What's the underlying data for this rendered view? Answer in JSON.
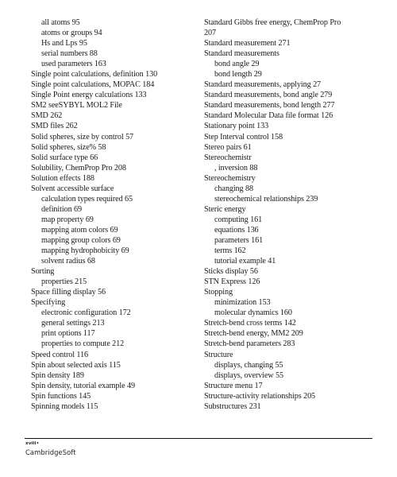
{
  "document": {
    "type": "index-page",
    "page_label": "xviii•",
    "publisher": "CambridgeSoft"
  },
  "columns": [
    {
      "name": "left-column",
      "entries": [
        {
          "text": "all atoms 95",
          "level": 1
        },
        {
          "text": "atoms or groups 94",
          "level": 1
        },
        {
          "text": "Hs and Lps 95",
          "level": 1
        },
        {
          "text": "serial numbers 88",
          "level": 1
        },
        {
          "text": "used parameters 163",
          "level": 1
        },
        {
          "text": "Single point calculations, definition 130",
          "level": 0
        },
        {
          "text": "Single point calculations, MOPAC 184",
          "level": 0
        },
        {
          "text": "Single Point energy calculations 133",
          "level": 0
        },
        {
          "text": "SM2 seeSYBYL MOL2 File",
          "level": 0
        },
        {
          "text": "SMD 262",
          "level": 0
        },
        {
          "text": "SMD files 262",
          "level": 0
        },
        {
          "text": "Solid spheres, size by control 57",
          "level": 0
        },
        {
          "text": "Solid spheres, size% 58",
          "level": 0
        },
        {
          "text": "Solid surface type 66",
          "level": 0
        },
        {
          "text": "Solubility, ChemProp Pro 208",
          "level": 0
        },
        {
          "text": "Solution effects 188",
          "level": 0
        },
        {
          "text": "Solvent accessible surface",
          "level": 0
        },
        {
          "text": "calculation types required 65",
          "level": 1
        },
        {
          "text": "definition 69",
          "level": 1
        },
        {
          "text": "map property 69",
          "level": 1
        },
        {
          "text": "mapping atom colors 69",
          "level": 1
        },
        {
          "text": "mapping group colors 69",
          "level": 1
        },
        {
          "text": "mapping hydrophobicity 69",
          "level": 1
        },
        {
          "text": "solvent radius 68",
          "level": 1
        },
        {
          "text": "Sorting",
          "level": 0
        },
        {
          "text": "properties 215",
          "level": 1
        },
        {
          "text": "Space filling display 56",
          "level": 0
        },
        {
          "text": "Specifying",
          "level": 0
        },
        {
          "text": "electronic configuration 172",
          "level": 1
        },
        {
          "text": "general settings 213",
          "level": 1
        },
        {
          "text": "print options 117",
          "level": 1
        },
        {
          "text": "properties to compute 212",
          "level": 1
        },
        {
          "text": "Speed control 116",
          "level": 0
        },
        {
          "text": "Spin about selected axis 115",
          "level": 0
        },
        {
          "text": "Spin density 189",
          "level": 0
        },
        {
          "text": "Spin density, tutorial example 49",
          "level": 0
        },
        {
          "text": "Spin functions 145",
          "level": 0
        },
        {
          "text": "Spinning models 115",
          "level": 0
        }
      ]
    },
    {
      "name": "right-column",
      "entries": [
        {
          "text": "Standard Gibbs free energy, ChemProp Pro",
          "level": 0
        },
        {
          "text": "207",
          "level": 0
        },
        {
          "text": "Standard measurement 271",
          "level": 0
        },
        {
          "text": "Standard measurements",
          "level": 0
        },
        {
          "text": "bond angle 29",
          "level": 1
        },
        {
          "text": "bond length 29",
          "level": 1
        },
        {
          "text": "Standard measurements, applying 27",
          "level": 0
        },
        {
          "text": "Standard measurements, bond angle 279",
          "level": 0
        },
        {
          "text": "Standard measurements, bond length 277",
          "level": 0
        },
        {
          "text": "Standard Molecular Data file format 126",
          "level": 0
        },
        {
          "text": "Stationary point 133",
          "level": 0
        },
        {
          "text": "Step Interval control 158",
          "level": 0
        },
        {
          "text": "Stereo pairs 61",
          "level": 0
        },
        {
          "text": "Stereochemistr",
          "level": 0
        },
        {
          "text": ", inversion 88",
          "level": 1
        },
        {
          "text": "Stereochemistry",
          "level": 0
        },
        {
          "text": "changing 88",
          "level": 1
        },
        {
          "text": "stereochemical relationships 239",
          "level": 1
        },
        {
          "text": "Steric energy",
          "level": 0
        },
        {
          "text": "computing 161",
          "level": 1
        },
        {
          "text": "equations 136",
          "level": 1
        },
        {
          "text": "parameters 161",
          "level": 1
        },
        {
          "text": "terms 162",
          "level": 1
        },
        {
          "text": "tutorial example 41",
          "level": 1
        },
        {
          "text": "Sticks display 56",
          "level": 0
        },
        {
          "text": "STN Express 126",
          "level": 0
        },
        {
          "text": "Stopping",
          "level": 0
        },
        {
          "text": "minimization 153",
          "level": 1
        },
        {
          "text": "molecular dynamics 160",
          "level": 1
        },
        {
          "text": "Stretch-bend cross terms 142",
          "level": 0
        },
        {
          "text": "Stretch-bend energy, MM2 209",
          "level": 0
        },
        {
          "text": "Stretch-bend parameters 283",
          "level": 0
        },
        {
          "text": "Structure",
          "level": 0
        },
        {
          "text": "displays, changing 55",
          "level": 1
        },
        {
          "text": "displays, overview 55",
          "level": 1
        },
        {
          "text": "Structure menu 17",
          "level": 0
        },
        {
          "text": "Structure-activity relationships 205",
          "level": 0
        },
        {
          "text": "Substructures 231",
          "level": 0
        }
      ]
    }
  ]
}
